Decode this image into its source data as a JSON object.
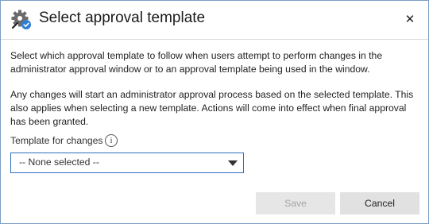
{
  "dialog": {
    "title": "Select approval template",
    "title_icon": "settings-approval-icon",
    "close_glyph": "✕"
  },
  "content": {
    "paragraph_1": "Select which approval template to follow when users attempt to perform changes in the administrator approval window or to an approval template being used in the window.",
    "paragraph_2": "Any changes will start an administrator approval process based on the selected template. This also applies when selecting a new template. Actions will come into effect when final approval has been granted.",
    "field_label": "Template for changes",
    "info_glyph": "i",
    "select_value": "-- None selected --"
  },
  "buttons": {
    "save_label": "Save",
    "save_enabled": false,
    "cancel_label": "Cancel"
  },
  "colors": {
    "window_border": "#7a9cc6",
    "select_border": "#2f6fbf",
    "check_badge": "#2f7fd1"
  }
}
